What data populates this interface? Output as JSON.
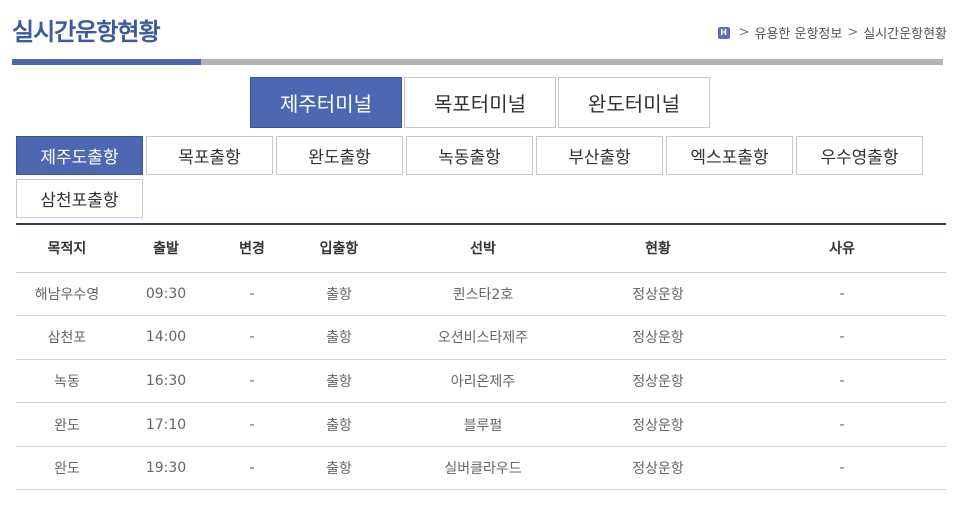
{
  "page": {
    "title": "실시간운항현황"
  },
  "breadcrumb": {
    "home_icon": "H",
    "separator": ">",
    "items": [
      "유용한 운항정보",
      "실시간운항현황"
    ]
  },
  "colors": {
    "accent": "#4d68b2",
    "title": "#3d5a9c",
    "table_rule": "#2b3b6e"
  },
  "terminal_tabs": [
    {
      "label": "제주터미널",
      "active": true
    },
    {
      "label": "목포터미널",
      "active": false
    },
    {
      "label": "완도터미널",
      "active": false
    }
  ],
  "route_tabs": [
    {
      "label": "제주도출항",
      "active": true
    },
    {
      "label": "목포출항",
      "active": false
    },
    {
      "label": "완도출항",
      "active": false
    },
    {
      "label": "녹동출항",
      "active": false
    },
    {
      "label": "부산출항",
      "active": false
    },
    {
      "label": "엑스포출항",
      "active": false
    },
    {
      "label": "우수영출항",
      "active": false
    },
    {
      "label": "삼천포출항",
      "active": false
    }
  ],
  "table": {
    "columns": [
      "목적지",
      "출발",
      "변경",
      "입출항",
      "선박",
      "현황",
      "사유"
    ],
    "rows": [
      [
        "해남우수영",
        "09:30",
        "-",
        "출항",
        "퀸스타2호",
        "정상운항",
        "-"
      ],
      [
        "삼천포",
        "14:00",
        "-",
        "출항",
        "오션비스타제주",
        "정상운항",
        "-"
      ],
      [
        "녹동",
        "16:30",
        "-",
        "출항",
        "아리온제주",
        "정상운항",
        "-"
      ],
      [
        "완도",
        "17:10",
        "-",
        "출항",
        "블루펄",
        "정상운항",
        "-"
      ],
      [
        "완도",
        "19:30",
        "-",
        "출항",
        "실버클라우드",
        "정상운항",
        "-"
      ]
    ]
  }
}
